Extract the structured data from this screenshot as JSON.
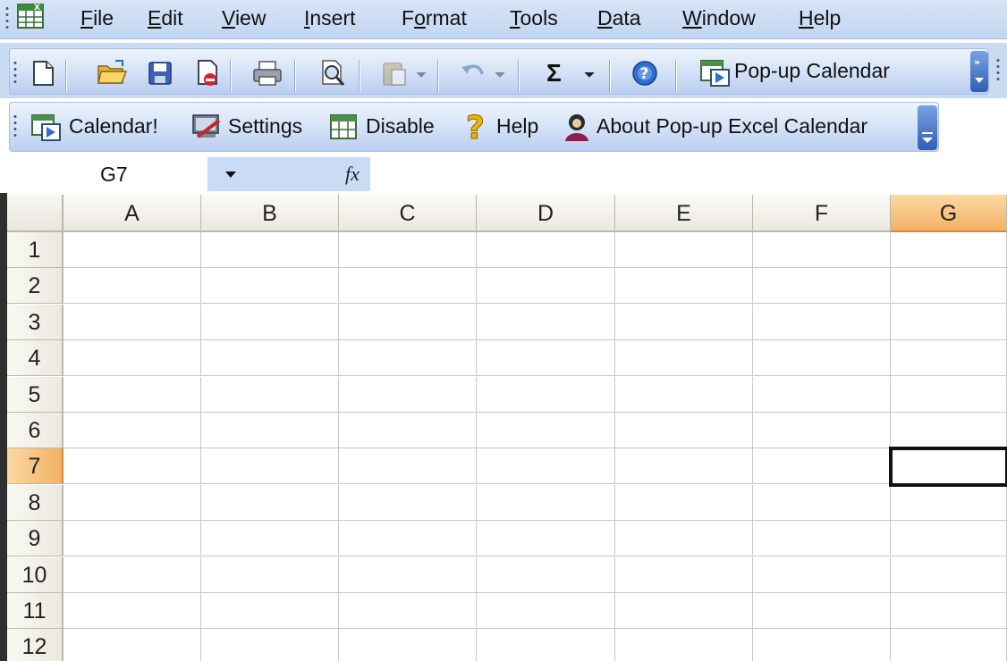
{
  "menubar": {
    "items": [
      "File",
      "Edit",
      "View",
      "Insert",
      "Format",
      "Tools",
      "Data",
      "Window",
      "Help"
    ],
    "underline_chars": [
      "F",
      "E",
      "V",
      "I",
      "o",
      "T",
      "D",
      "W",
      "H"
    ]
  },
  "standard_toolbar": {
    "icons": [
      "new-document-icon",
      "open-folder-icon",
      "save-icon",
      "permission-icon",
      "print-icon",
      "print-preview-icon",
      "paste-icon",
      "undo-icon",
      "autosum-icon",
      "help-icon",
      "popup-calendar-icon"
    ],
    "autosum_label": "Σ",
    "calendar_label": "Pop-up Calendar"
  },
  "addin_toolbar": {
    "calendar_label": "Calendar!",
    "settings_label": "Settings",
    "disable_label": "Disable",
    "help_label": "Help",
    "about_label": "About Pop-up Excel Calendar"
  },
  "formula_bar": {
    "name_box": "G7",
    "fx_label": "fx",
    "formula": ""
  },
  "sheet": {
    "columns": [
      "A",
      "B",
      "C",
      "D",
      "E",
      "F",
      "G"
    ],
    "rows": [
      "1",
      "2",
      "3",
      "4",
      "5",
      "6",
      "7",
      "8",
      "9",
      "10",
      "11",
      "12"
    ],
    "active_column": "G",
    "active_row": "7",
    "selected_cell": "G7"
  },
  "colors": {
    "menu_bg": "#c3d5f0",
    "toolbar_bg": "#d2e1f6",
    "active_header": "#f3b165",
    "gridline": "#c8c8c8"
  }
}
